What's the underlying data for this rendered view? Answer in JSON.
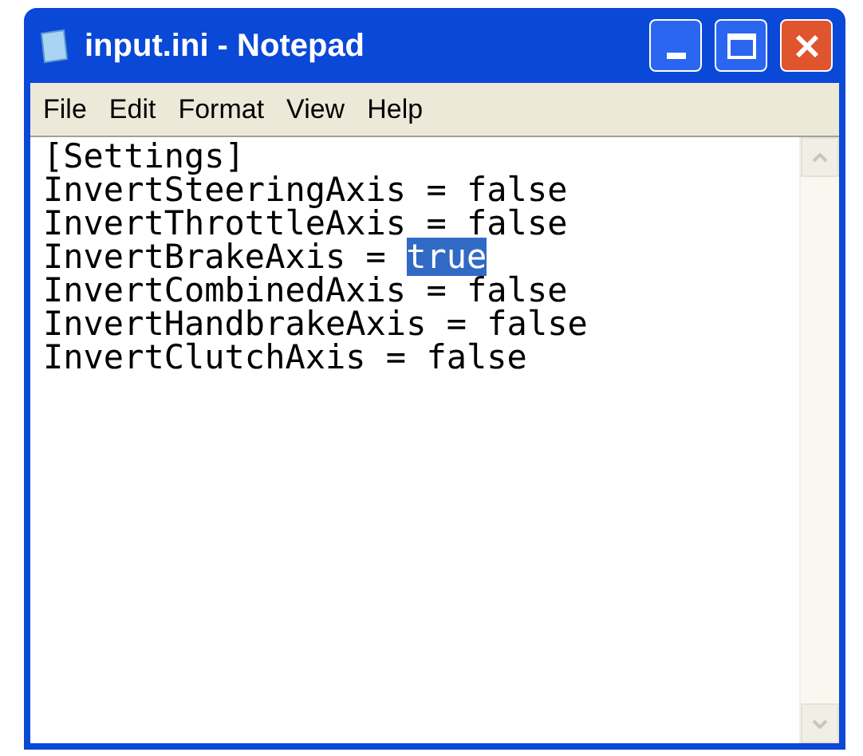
{
  "window": {
    "title": "input.ini - Notepad"
  },
  "menu": [
    "File",
    "Edit",
    "Format",
    "View",
    "Help"
  ],
  "lines": [
    {
      "kind": "section",
      "text": "[Settings]"
    },
    {
      "kind": "entry",
      "text": "InvertSteeringAxis = ",
      "value": "false",
      "selected": false
    },
    {
      "kind": "entry",
      "text": "InvertThrottleAxis = ",
      "value": "false",
      "selected": false
    },
    {
      "kind": "entry",
      "text": "InvertBrakeAxis = ",
      "value": "true",
      "selected": true
    },
    {
      "kind": "entry",
      "text": "InvertCombinedAxis = ",
      "value": "false",
      "selected": false
    },
    {
      "kind": "entry",
      "text": "InvertHandbrakeAxis = ",
      "value": "false",
      "selected": false
    },
    {
      "kind": "entry",
      "text": "InvertClutchAxis = ",
      "value": "false",
      "selected": false
    }
  ]
}
